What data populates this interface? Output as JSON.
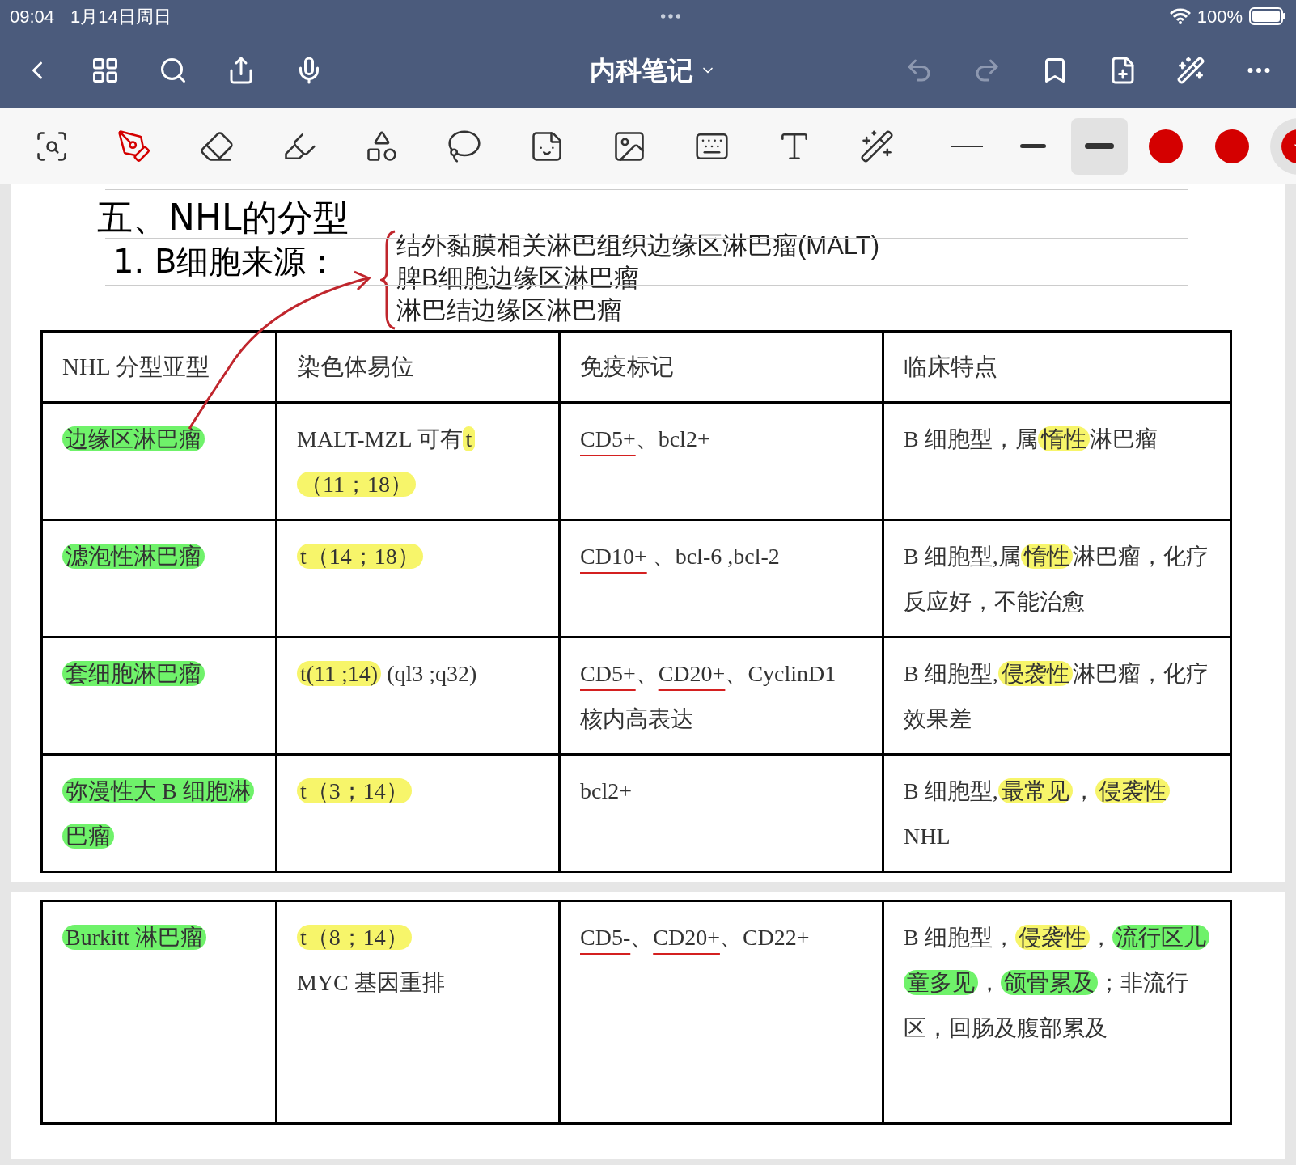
{
  "status_bar": {
    "time": "09:04",
    "date": "1月14日周日",
    "battery": "100%"
  },
  "nav": {
    "title": "内科笔记"
  },
  "toolbar": {
    "tools": [
      {
        "kind": "zoom",
        "selected": false
      },
      {
        "kind": "pen",
        "selected": true
      },
      {
        "kind": "eraser",
        "selected": false
      },
      {
        "kind": "highlighter",
        "selected": false
      },
      {
        "kind": "shapes",
        "selected": false
      },
      {
        "kind": "lasso",
        "selected": false
      },
      {
        "kind": "sticker",
        "selected": false
      },
      {
        "kind": "image",
        "selected": false
      },
      {
        "kind": "keyboard",
        "selected": false
      },
      {
        "kind": "text",
        "selected": false
      },
      {
        "kind": "laser",
        "selected": false
      }
    ],
    "widths": [
      {
        "kind": "thin",
        "selected": false
      },
      {
        "kind": "medium",
        "selected": false
      },
      {
        "kind": "thick",
        "selected": true
      }
    ],
    "colors": [
      {
        "color": "#d40000",
        "selected": false
      },
      {
        "color": "#d40000",
        "selected": false
      },
      {
        "color": "#d40000",
        "selected": true
      }
    ]
  },
  "page_1": {
    "heading": "五、NHL的分型",
    "subheading": "1. B细胞来源：",
    "bracket_items": [
      "结外黏膜相关淋巴组织边缘区淋巴瘤(MALT)",
      "脾B细胞边缘区淋巴瘤",
      "淋巴结边缘区淋巴瘤"
    ],
    "table": {
      "columns": [
        "NHL 分型亚型",
        "染色体易位",
        "免疫标记",
        "临床特点"
      ],
      "rows": [
        [
          [
            [
              {
                "text": "边缘区淋巴瘤",
                "kind": "green"
              }
            ]
          ],
          [
            [
              {
                "text": "MALT-MZL  可有",
                "kind": "plain"
              },
              {
                "text": "t（11；18）",
                "kind": "yellow"
              }
            ]
          ],
          [
            [
              {
                "text": "CD5+",
                "kind": "underline"
              },
              {
                "text": "、bcl2+",
                "kind": "plain"
              }
            ]
          ],
          [
            [
              {
                "text": "B 细胞型，属",
                "kind": "plain"
              },
              {
                "text": "惰性",
                "kind": "yellow"
              },
              {
                "text": "淋巴瘤",
                "kind": "plain"
              }
            ]
          ]
        ],
        [
          [
            [
              {
                "text": "滤泡性淋巴瘤",
                "kind": "green"
              }
            ]
          ],
          [
            [
              {
                "text": "t（14；18）",
                "kind": "yellow"
              }
            ]
          ],
          [
            [
              {
                "text": "CD10+",
                "kind": "underline"
              },
              {
                "text": " 、bcl-6 ,bcl-2",
                "kind": "plain"
              }
            ]
          ],
          [
            [
              {
                "text": "B 细胞型,属",
                "kind": "plain"
              },
              {
                "text": "惰性",
                "kind": "yellow"
              },
              {
                "text": "淋巴瘤，化疗反应好，不能治愈",
                "kind": "plain"
              }
            ]
          ]
        ],
        [
          [
            [
              {
                "text": "套细胞淋巴瘤",
                "kind": "green"
              }
            ]
          ],
          [
            [
              {
                "text": "t(11 ;14)",
                "kind": "yellow"
              },
              {
                "text": " (ql3 ;q32)",
                "kind": "plain"
              }
            ]
          ],
          [
            [
              {
                "text": "CD5+",
                "kind": "underline"
              },
              {
                "text": "、",
                "kind": "plain"
              },
              {
                "text": "CD20+",
                "kind": "underline"
              },
              {
                "text": "、CyclinD1 核内高表达",
                "kind": "plain"
              }
            ]
          ],
          [
            [
              {
                "text": "B 细胞型,",
                "kind": "plain"
              },
              {
                "text": "侵袭性",
                "kind": "yellow"
              },
              {
                "text": "淋巴瘤，化疗效果差",
                "kind": "plain"
              }
            ]
          ]
        ],
        [
          [
            [
              {
                "text": "弥漫性大 B 细胞淋巴瘤",
                "kind": "green"
              }
            ]
          ],
          [
            [
              {
                "text": "t（3；14）",
                "kind": "yellow"
              }
            ]
          ],
          [
            [
              {
                "text": "bcl2+",
                "kind": "plain"
              }
            ]
          ],
          [
            [
              {
                "text": "B 细胞型,",
                "kind": "plain"
              },
              {
                "text": "最常见",
                "kind": "yellow"
              },
              {
                "text": "，",
                "kind": "plain"
              },
              {
                "text": "侵袭性",
                "kind": "yellow"
              }
            ],
            [
              {
                "text": "NHL",
                "kind": "plain"
              }
            ]
          ]
        ]
      ]
    }
  },
  "page_2": {
    "table": {
      "rows": [
        [
          [
            [
              {
                "text": "Burkitt 淋巴瘤",
                "kind": "green"
              }
            ]
          ],
          [
            [
              {
                "text": "t（8；14）",
                "kind": "yellow"
              }
            ],
            [
              {
                "text": "MYC 基因重排",
                "kind": "plain"
              }
            ]
          ],
          [
            [
              {
                "text": "CD5-",
                "kind": "underline"
              },
              {
                "text": "、",
                "kind": "plain"
              },
              {
                "text": "CD20+",
                "kind": "underline"
              },
              {
                "text": "、CD22+",
                "kind": "plain"
              }
            ]
          ],
          [
            [
              {
                "text": "B 细胞型，",
                "kind": "plain"
              },
              {
                "text": "侵袭性",
                "kind": "yellow"
              },
              {
                "text": "，",
                "kind": "plain"
              },
              {
                "text": "流行区儿童多见",
                "kind": "green"
              },
              {
                "text": "，",
                "kind": "plain"
              },
              {
                "text": "颌骨累及",
                "kind": "green"
              },
              {
                "text": "；非流行区，回肠及腹部累及",
                "kind": "plain"
              }
            ]
          ]
        ]
      ]
    }
  }
}
